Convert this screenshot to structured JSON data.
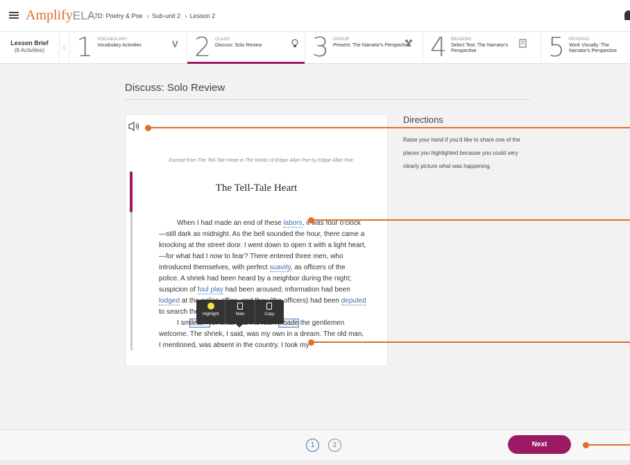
{
  "header": {
    "brand_amplify": "Amplify",
    "brand_ela": "ELA",
    "breadcrumbs": [
      "7D: Poetry & Poe",
      "Sub-unit 2",
      "Lesson 2"
    ]
  },
  "strip": {
    "brief_title": "Lesson Brief",
    "brief_sub": "(8 Activities)",
    "activities": [
      {
        "num": "1",
        "kind": "VOCABULARY",
        "title": "Vocabulary Activities",
        "icon": "V",
        "active": false
      },
      {
        "num": "2",
        "kind": "CLASS",
        "title": "Discuss: Solo Review",
        "icon": "lightbulb-icon",
        "active": true
      },
      {
        "num": "3",
        "kind": "GROUP",
        "title": "Present: The Narrator's Perspective",
        "icon": "group-icon",
        "active": false
      },
      {
        "num": "4",
        "kind": "READING",
        "title": "Select Text: The Narrator's Perspective",
        "icon": "book-icon",
        "active": false
      },
      {
        "num": "5",
        "kind": "READING",
        "title": "Work Visually: The Narrator's Perspective",
        "icon": "",
        "active": false
      }
    ]
  },
  "main": {
    "heading": "Discuss: Solo Review",
    "excerpt": "Excerpt from The Tell-Tale Heart in The Works of Edgar Allan Poe by Edgar Allan Poe",
    "story_title": "The Tell-Tale Heart",
    "p1": {
      "a": "When I had made an end of these ",
      "labors": "labors",
      "b": ", it was four o'clock—still dark as midnight. As the bell sounded the hour, there came a knocking at the street door. I went down to open it with a light heart,—for what had I ",
      "now": "now",
      "c": " to fear? There entered three men, who introduced themselves, with perfect ",
      "suavity": "suavity",
      "d": ", as officers of the police. A shriek had been heard by a neighbor during the night; suspicion of ",
      "foul_play": "foul play",
      "e": " had been aroused; information had been ",
      "lodged": "lodged",
      "f": " at the police office, and they (the officers) had been ",
      "deputed": "deputed",
      "g": " to search the ",
      "premises": "premises",
      "h": "."
    },
    "p2": {
      "a": "I sm",
      "sel1": "iled,—",
      "b": "for ",
      "what": "what",
      "c": " had I to fear? ",
      "sel2": "I bade",
      "d": " the gentlemen welcome. The shriek, I said, was my own in a dream. The old man, I mentioned, was absent in the country. I took my"
    },
    "toolbar": {
      "highlight": "Highlight",
      "note": "Note",
      "copy": "Copy"
    }
  },
  "directions": {
    "title": "Directions",
    "text": "Raise your hand if you'd like to share one of the places you highlighted because you could very clearly picture what was happening."
  },
  "footer": {
    "pages": [
      "1",
      "2"
    ],
    "next_label": "Next"
  },
  "colors": {
    "accent": "#9c1a64",
    "callout": "#e06d2c",
    "link": "#3a6fb0"
  }
}
